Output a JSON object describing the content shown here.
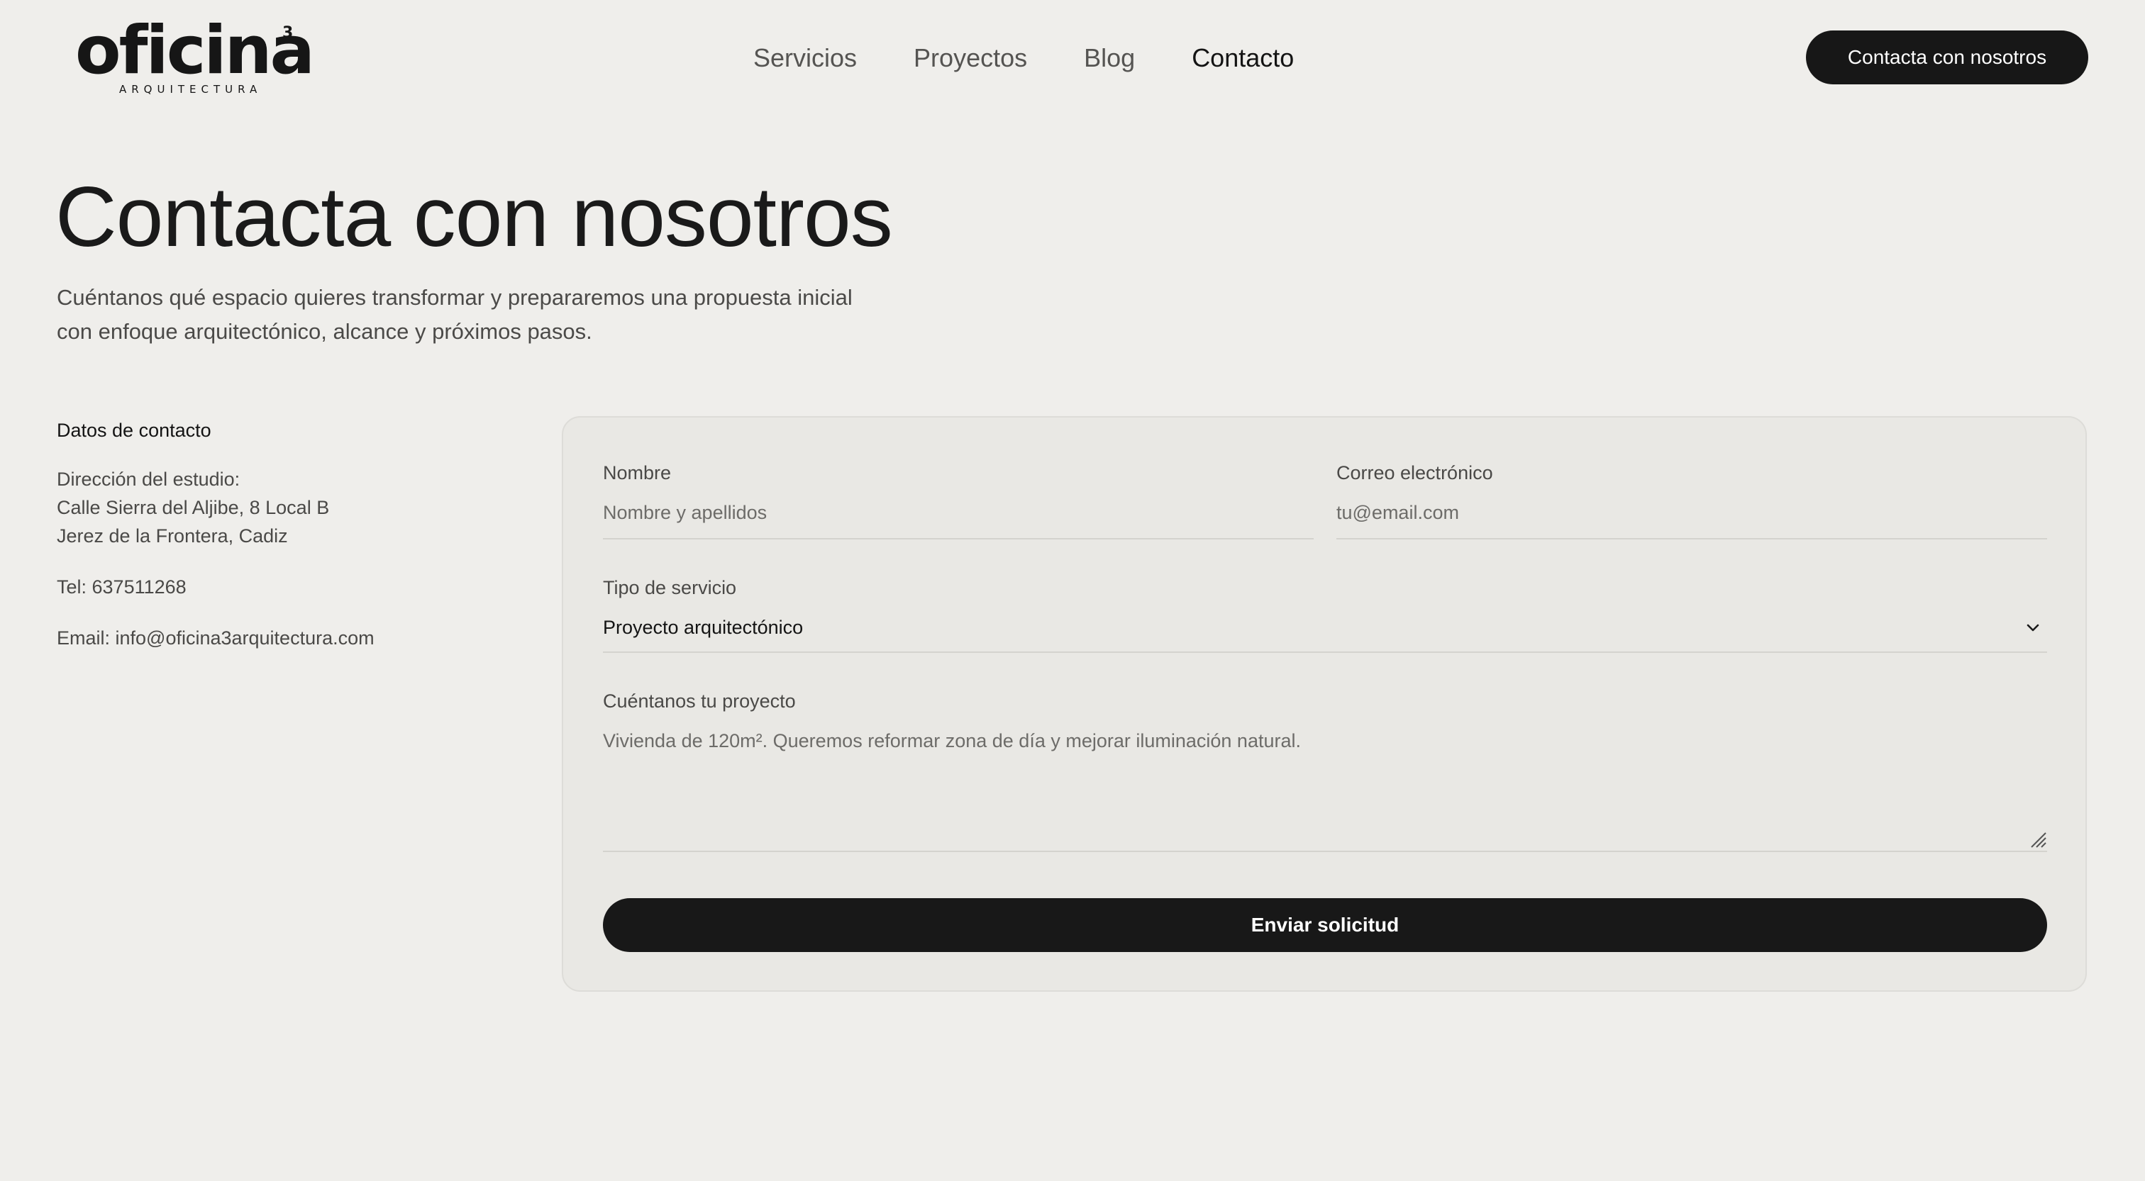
{
  "header": {
    "logo": {
      "wordmark": "oficina",
      "superscript": "3",
      "subtitle": "ARQUITECTURA"
    },
    "nav": [
      {
        "label": "Servicios",
        "active": false
      },
      {
        "label": "Proyectos",
        "active": false
      },
      {
        "label": "Blog",
        "active": false
      },
      {
        "label": "Contacto",
        "active": true
      }
    ],
    "cta_label": "Contacta con nosotros"
  },
  "hero": {
    "title": "Contacta con nosotros",
    "intro": "Cuéntanos qué espacio quieres transformar y prepararemos una propuesta inicial con enfoque arquitectónico, alcance y próximos pasos."
  },
  "contact": {
    "heading": "Datos de contacto",
    "address_label": "Dirección del estudio:",
    "address_line1": "Calle Sierra del Aljibe, 8 Local B",
    "address_line2": "Jerez de la Frontera, Cadiz",
    "phone": "Tel: 637511268",
    "email": "Email: info@oficina3arquitectura.com"
  },
  "form": {
    "name": {
      "label": "Nombre",
      "placeholder": "Nombre y apellidos"
    },
    "email": {
      "label": "Correo electrónico",
      "placeholder": "tu@email.com"
    },
    "service": {
      "label": "Tipo de servicio",
      "value": "Proyecto arquitectónico"
    },
    "project": {
      "label": "Cuéntanos tu proyecto",
      "placeholder": "Vivienda de 120m². Queremos reformar zona de día y mejorar iluminación natural."
    },
    "submit_label": "Enviar solicitud"
  },
  "icons": {
    "select": "chevron-down-icon",
    "textarea": "resize-grip-icon"
  },
  "colors": {
    "background": "#efeeeb",
    "card": "#e9e8e4",
    "button": "#171717",
    "text": "#1b1b1b"
  }
}
